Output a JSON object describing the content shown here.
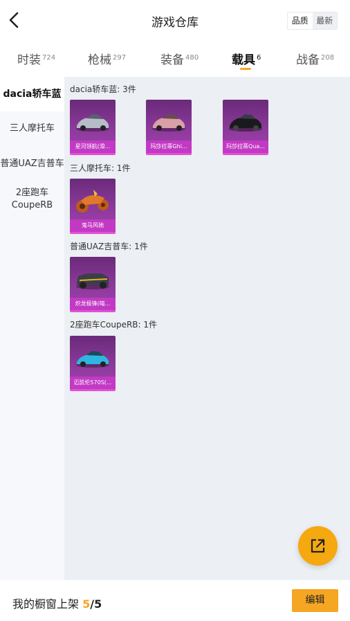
{
  "header": {
    "title": "游戏仓库",
    "sort_quality": "品质",
    "sort_new": "最新",
    "back_icon": "chevron-left-icon"
  },
  "tabs": [
    {
      "label": "时装",
      "count": "724"
    },
    {
      "label": "枪械",
      "count": "297"
    },
    {
      "label": "装备",
      "count": "480"
    },
    {
      "label": "载具",
      "count": "6"
    },
    {
      "label": "战备",
      "count": "208"
    }
  ],
  "active_tab": "载具",
  "sidebar": {
    "items": [
      {
        "label": "dacia轿车蓝"
      },
      {
        "label": "三人摩托车"
      },
      {
        "label": "普通UAZ吉普车"
      },
      {
        "label": "2座跑车",
        "label2": "CoupeRB"
      }
    ]
  },
  "groups": [
    {
      "title": "dacia轿车蓝: 3件",
      "items": [
        {
          "name": "星河领航(滑...",
          "color": "#b8bcc8"
        },
        {
          "name": "玛莎拉蒂Ghi...",
          "color": "#d9a0a8"
        },
        {
          "name": "玛莎拉蒂Qua...",
          "color": "#1a1a1e"
        }
      ]
    },
    {
      "title": "三人摩托车: 1件",
      "items": [
        {
          "name": "鬼马风驰",
          "color": "#e07a2a"
        }
      ]
    },
    {
      "title": "普通UAZ吉普车: 1件",
      "items": [
        {
          "name": "炽龙极锋(喵...",
          "color": "#3a3f48"
        }
      ]
    },
    {
      "title": "2座跑车CoupeRB: 1件",
      "items": [
        {
          "name": "迈凯伦570S(...",
          "color": "#2fb6e0"
        }
      ]
    }
  ],
  "footer": {
    "label": "我的橱窗上架",
    "current": "5",
    "total": "/5",
    "edit_label": "编辑"
  },
  "fab_icon": "share-external-icon",
  "colors": {
    "accent": "#f5a623",
    "card_bg": "#8c3a9a",
    "card_label_bg": "#c23ac4"
  }
}
